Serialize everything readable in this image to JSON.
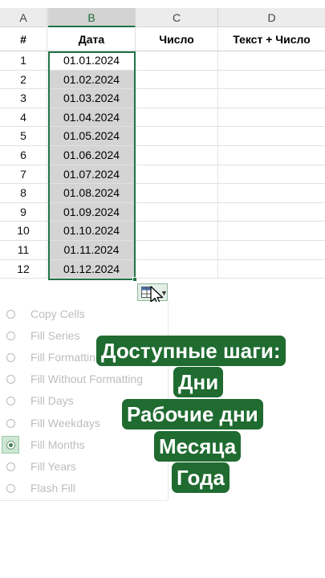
{
  "columns": [
    "A",
    "B",
    "C",
    "D"
  ],
  "header_row": {
    "a": "#",
    "b": "Дата",
    "c": "Число",
    "d": "Текст + Число"
  },
  "rows": [
    {
      "num": "1",
      "date": "01.01.2024"
    },
    {
      "num": "2",
      "date": "01.02.2024"
    },
    {
      "num": "3",
      "date": "01.03.2024"
    },
    {
      "num": "4",
      "date": "01.04.2024"
    },
    {
      "num": "5",
      "date": "01.05.2024"
    },
    {
      "num": "6",
      "date": "01.06.2024"
    },
    {
      "num": "7",
      "date": "01.07.2024"
    },
    {
      "num": "8",
      "date": "01.08.2024"
    },
    {
      "num": "9",
      "date": "01.09.2024"
    },
    {
      "num": "10",
      "date": "01.10.2024"
    },
    {
      "num": "11",
      "date": "01.11.2024"
    },
    {
      "num": "12",
      "date": "01.12.2024"
    }
  ],
  "autofill_menu": {
    "items": [
      {
        "label": "Copy Cells",
        "checked": false
      },
      {
        "label": "Fill Series",
        "checked": false
      },
      {
        "label": "Fill Formatting Only",
        "checked": false
      },
      {
        "label": "Fill Without Formatting",
        "checked": false
      },
      {
        "label": "Fill Days",
        "checked": false
      },
      {
        "label": "Fill Weekdays",
        "checked": false
      },
      {
        "label": "Fill Months",
        "checked": true
      },
      {
        "label": "Fill Years",
        "checked": false
      },
      {
        "label": "Flash Fill",
        "checked": false
      }
    ]
  },
  "overlay": {
    "title": "Доступные шаги:",
    "lines": [
      "Дни",
      "Рабочие дни",
      "Месяца",
      "Года"
    ]
  },
  "colors": {
    "accent": "#217346",
    "banner": "#1f6b30",
    "selection_fill": "#d4d4d4"
  },
  "icons": {
    "autofill_button": "autofill-options-icon",
    "pointer": "mouse-pointer-icon",
    "caret": "chevron-down-icon"
  }
}
